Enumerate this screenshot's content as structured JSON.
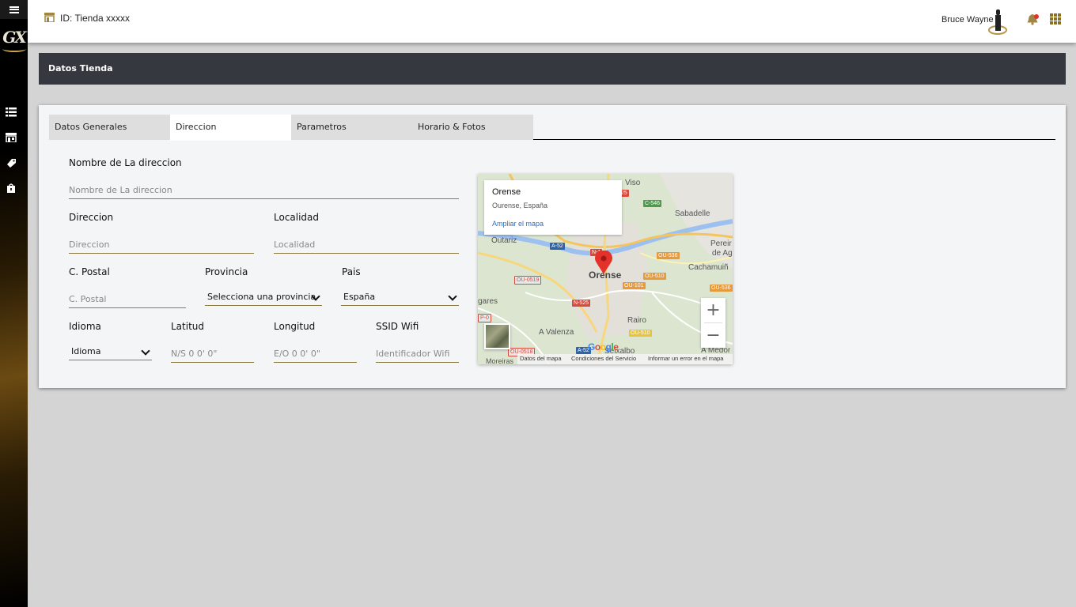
{
  "header": {
    "store_id": "ID: Tienda xxxxx",
    "user_name": "Bruce Wayne"
  },
  "sidebar": {
    "logo_text": "GX",
    "icons": [
      "list-icon",
      "store-front-icon",
      "tag-icon",
      "shopping-bag-icon"
    ]
  },
  "section": {
    "title": "Datos Tienda"
  },
  "tabs": [
    {
      "label": "Datos Generales",
      "active": false
    },
    {
      "label": "Direccion",
      "active": true
    },
    {
      "label": "Parametros",
      "active": false
    },
    {
      "label": "Horario & Fotos",
      "active": false
    }
  ],
  "form": {
    "nombre_label": "Nombre de La direccion",
    "nombre_placeholder": "Nombre de La direccion",
    "direccion_label": "Direccion",
    "direccion_placeholder": "Direccion",
    "localidad_label": "Localidad",
    "localidad_placeholder": "Localidad",
    "cpostal_label": "C. Postal",
    "cpostal_placeholder": "C. Postal",
    "provincia_label": "Provincia",
    "provincia_value": "Selecciona una provincia",
    "pais_label": "Pais",
    "pais_value": "España",
    "idioma_label": "Idioma",
    "idioma_value": "Idioma",
    "latitud_label": "Latitud",
    "latitud_placeholder": "N/S 0  0' 0\"",
    "longitud_label": "Longitud",
    "longitud_placeholder": "E/O 0  0' 0\"",
    "ssid_label": "SSID Wifi",
    "ssid_placeholder": "Identificador Wifi"
  },
  "map": {
    "info_title": "Orense",
    "info_subtitle": "Ourense, España",
    "info_link": "Ampliar el mapa",
    "city_label": "Orense",
    "places": [
      "Viso",
      "Sabadelle",
      "Outariz",
      "Pereir",
      "de Agu",
      "Cachamuiñ",
      "gares",
      "Rairo",
      "A Valenza",
      "Seixalbo",
      "A Medor",
      "Moreiras"
    ],
    "roads": [
      "C-546",
      "A-52",
      "N-1",
      "OU-536",
      "OU-510",
      "OU-0519",
      "OU-101",
      "N-525",
      "OU-536",
      "P-0",
      "OU-510",
      "OU-0518",
      "A-52",
      "525"
    ],
    "zoom_in": "+",
    "zoom_out": "−",
    "brand": "Google",
    "footer_data": "Datos del mapa",
    "footer_terms": "Condiciones del Servicio",
    "footer_report": "Informar un error en el mapa"
  },
  "colors": {
    "accent": "#8f7a44",
    "section_bg": "#35393f",
    "link": "#2a6ec7",
    "pin": "#e4322a"
  }
}
